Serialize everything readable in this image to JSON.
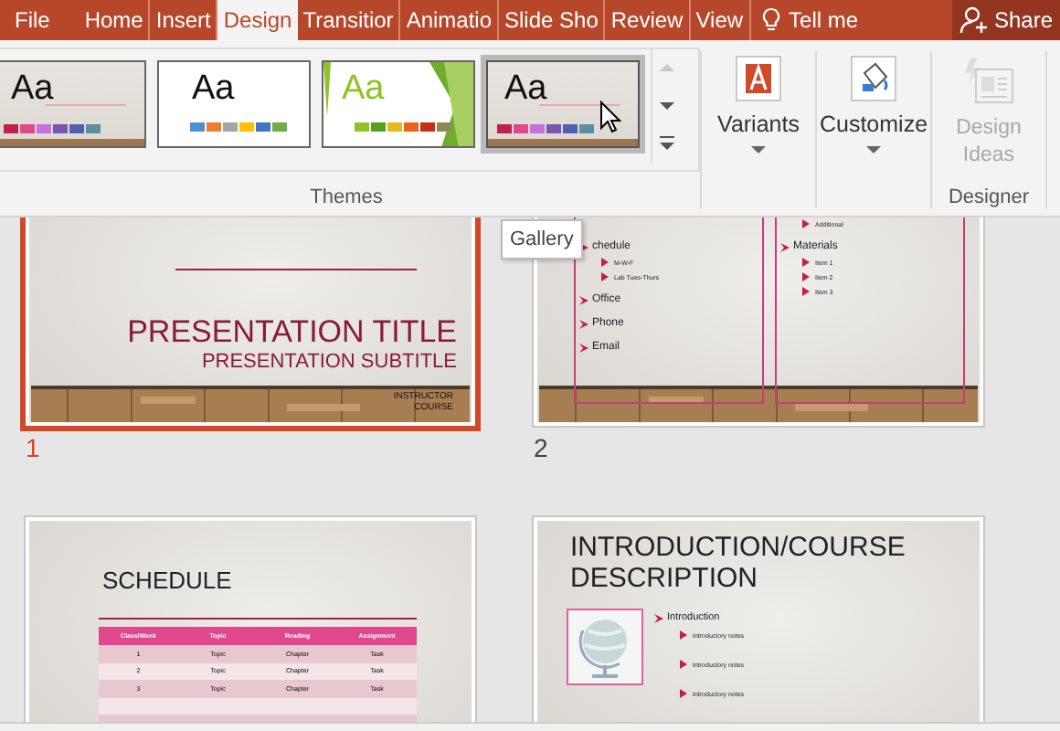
{
  "tabs": [
    {
      "label": "File",
      "selected": false
    },
    {
      "label": "Home",
      "selected": false
    },
    {
      "label": "Insert",
      "selected": false
    },
    {
      "label": "Design",
      "selected": true
    },
    {
      "label": "Transitior",
      "selected": false
    },
    {
      "label": "Animatio",
      "selected": false
    },
    {
      "label": "Slide Sho",
      "selected": false
    },
    {
      "label": "Review",
      "selected": false
    },
    {
      "label": "View",
      "selected": false
    }
  ],
  "tell_me": "Tell me",
  "share": "Share",
  "themes": {
    "label": "Themes",
    "items": [
      {
        "kind": "wood",
        "sample": "Aa",
        "selected": false
      },
      {
        "kind": "office",
        "sample": "Aa",
        "selected": false
      },
      {
        "kind": "facet",
        "sample": "Aa",
        "selected": false
      },
      {
        "kind": "wood",
        "sample": "Aa",
        "selected": true
      }
    ]
  },
  "variants": {
    "label": "Variants"
  },
  "customize": {
    "label": "Customize"
  },
  "designer": {
    "label": "Designer",
    "button": "Design Ideas",
    "disabled": true
  },
  "tooltip": "Gallery",
  "slides": [
    {
      "number": "1",
      "selected": true,
      "kind": "title",
      "title": "PRESENTATION TITLE",
      "subtitle": "PRESENTATION SUBTITLE",
      "footer": [
        "INSTRUCTOR",
        "COURSE"
      ]
    },
    {
      "number": "2",
      "selected": false,
      "kind": "two_column",
      "left": [
        {
          "text": "chedule",
          "children": [
            {
              "text": "M-W-F"
            },
            {
              "text": "Lab Tues-Thurs"
            }
          ]
        },
        {
          "text": "Office"
        },
        {
          "text": "Phone"
        },
        {
          "text": "Email"
        }
      ],
      "right": [
        {
          "children": [
            {
              "text": "Additional"
            }
          ]
        },
        {
          "text": "Materials",
          "children": [
            {
              "text": "Item 1"
            },
            {
              "text": "Item 2"
            },
            {
              "text": "Item 3"
            }
          ]
        }
      ]
    },
    {
      "selected": false,
      "kind": "table",
      "title": "SCHEDULE",
      "columns": [
        "Class/Week",
        "Topic",
        "Reading",
        "Assignment"
      ],
      "rows": [
        [
          "1",
          "Topic",
          "Chapter",
          "Task"
        ],
        [
          "2",
          "Topic",
          "Chapter",
          "Task"
        ],
        [
          "3",
          "Topic",
          "Chapter",
          "Task"
        ],
        [
          "",
          "",
          "",
          ""
        ],
        [
          "",
          "",
          "",
          ""
        ]
      ]
    },
    {
      "selected": false,
      "kind": "intro",
      "title": "INTRODUCTION/COURSE DESCRIPTION",
      "heading": "Introduction",
      "notes": [
        "Introductory notes",
        "Introductory notes",
        "Introductory notes"
      ]
    }
  ]
}
